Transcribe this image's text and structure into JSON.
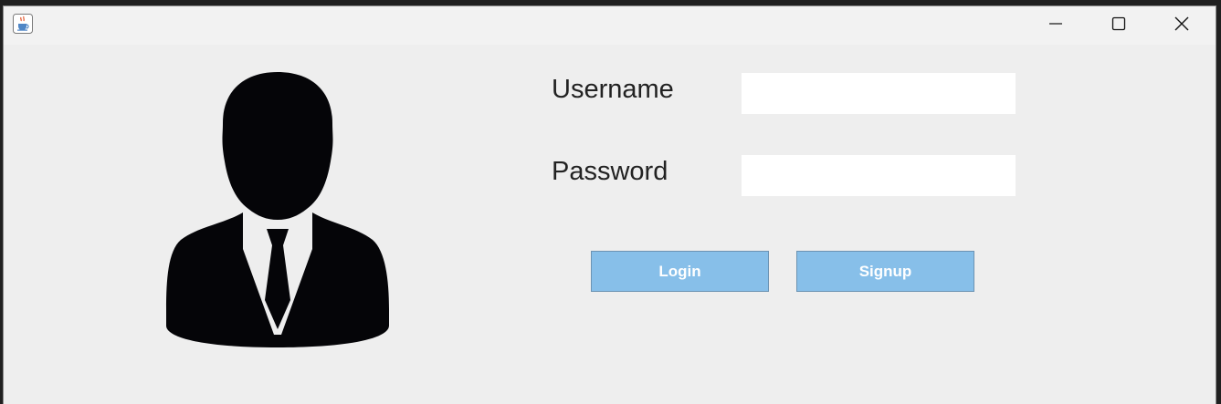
{
  "window": {
    "app_icon": "java-cup-icon",
    "controls": {
      "minimize_icon": "minimize-icon",
      "maximize_icon": "maximize-icon",
      "close_icon": "close-icon"
    }
  },
  "avatar": {
    "icon": "user-silhouette-icon"
  },
  "form": {
    "username_label": "Username",
    "username_value": "",
    "password_label": "Password",
    "password_value": ""
  },
  "buttons": {
    "login_label": "Login",
    "signup_label": "Signup"
  },
  "colors": {
    "button_bg": "#87bfe9",
    "button_border": "#6c93b3",
    "window_bg": "#eeeeee",
    "titlebar_bg": "#f2f2f2",
    "field_bg": "#ffffff"
  }
}
